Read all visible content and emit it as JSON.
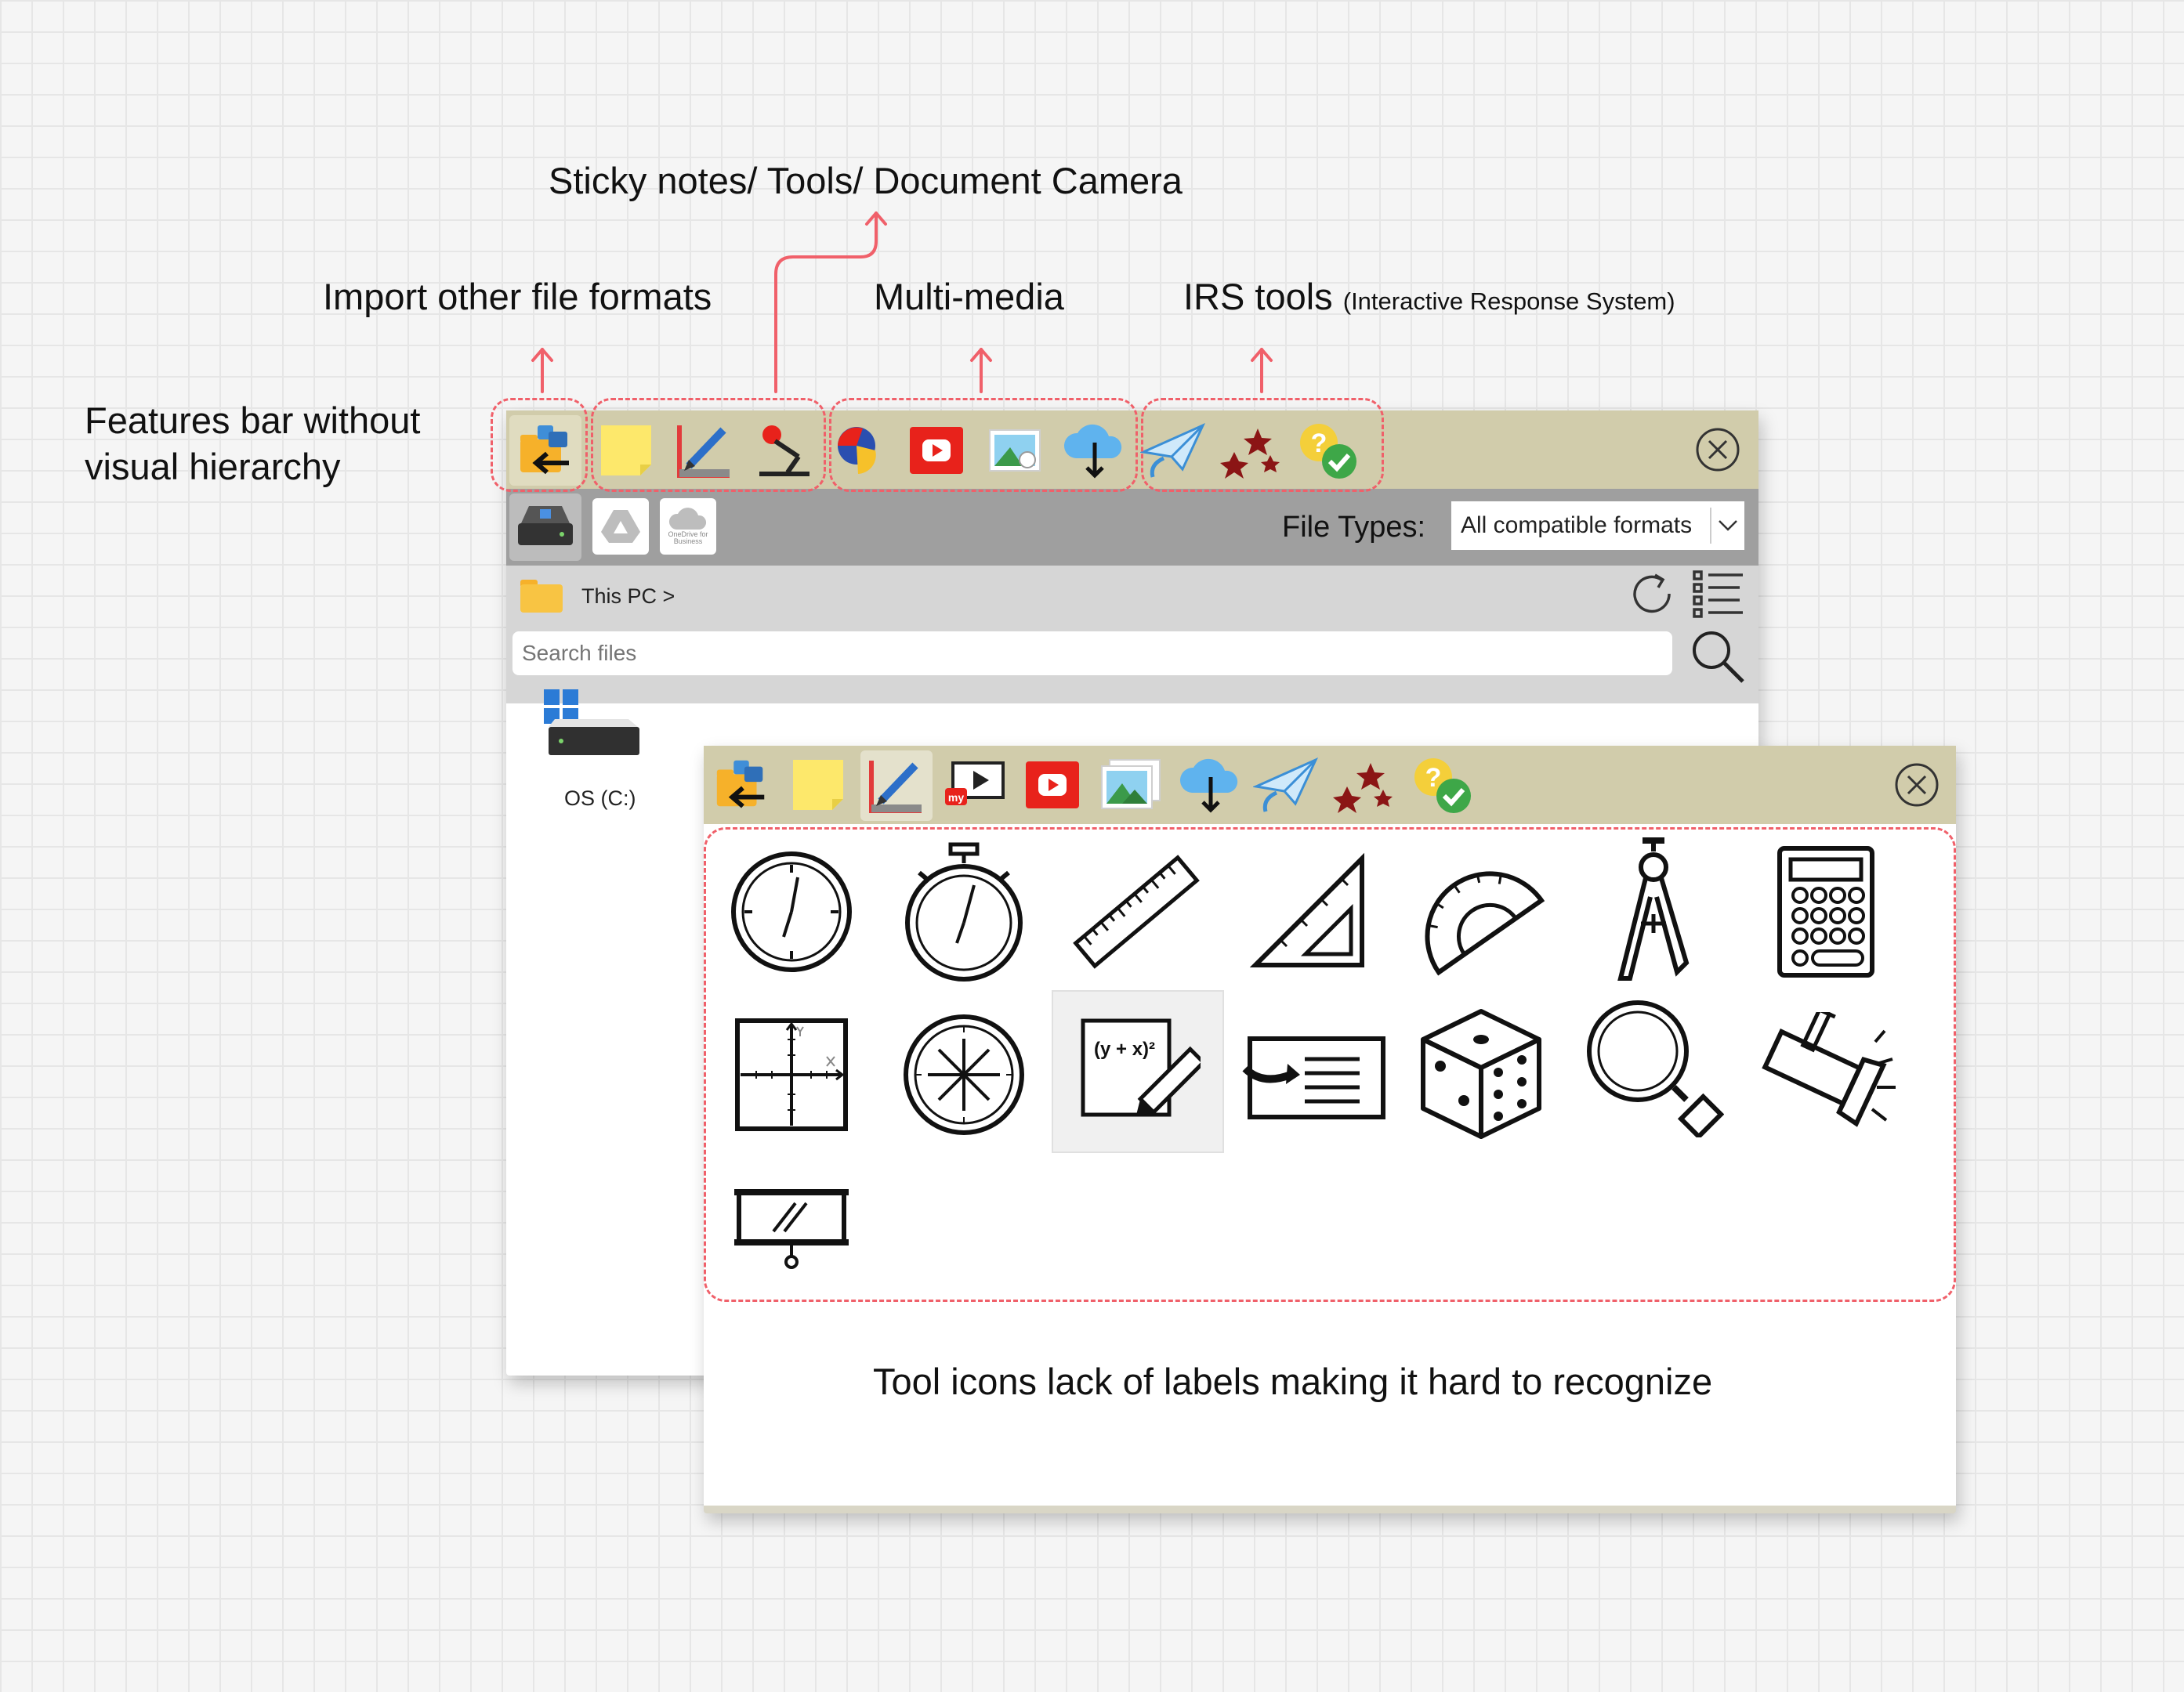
{
  "annotations": {
    "sticky_tools": "Sticky notes/ Tools/ Document Camera",
    "import": "Import other file formats",
    "multimedia": "Multi-media",
    "irs_main": "IRS tools",
    "irs_sub": "(Interactive Response System)",
    "features_line1": "Features bar without",
    "features_line2": "visual hierarchy",
    "tools_caption": "Tool icons lack of labels making it hard to recognize"
  },
  "file_window": {
    "source_labels": {
      "onedrive": "OneDrive for Business"
    },
    "file_types_label": "File Types:",
    "file_types_value": "All compatible formats",
    "breadcrumb": "This PC >",
    "search_placeholder": "Search files",
    "drive_label": "OS (C:)"
  },
  "tool_window": {
    "my_badge": "my",
    "equation_text": "(y + x)²"
  },
  "colors": {
    "toolbar_bg": "#d1ccab",
    "source_bar_bg": "#9f9f9f",
    "path_bar_bg": "#d6d6d6",
    "annotation_red": "#f0606a",
    "sticky_yellow": "#fde86b",
    "youtube_red": "#e8221b"
  }
}
